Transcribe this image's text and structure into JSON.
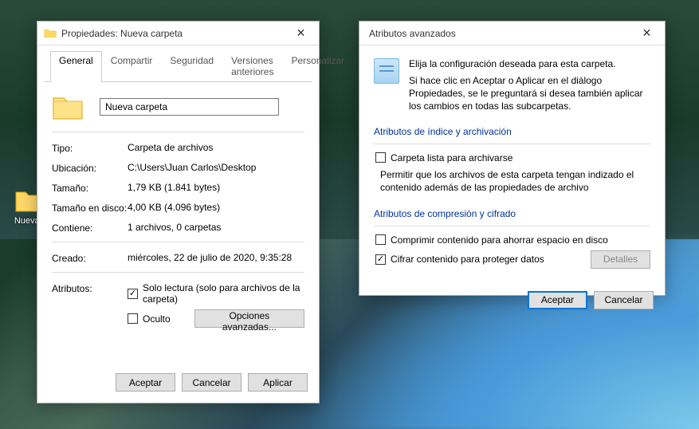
{
  "desktop": {
    "icon_label": "Nueva c"
  },
  "props": {
    "title": "Propiedades: Nueva carpeta",
    "tabs": {
      "general": "General",
      "compartir": "Compartir",
      "seguridad": "Seguridad",
      "versiones": "Versiones anteriores",
      "personalizar": "Personalizar"
    },
    "name_value": "Nueva carpeta",
    "tipo_label": "Tipo:",
    "tipo_value": "Carpeta de archivos",
    "ubicacion_label": "Ubicación:",
    "ubicacion_value": "C:\\Users\\Juan Carlos\\Desktop",
    "tamano_label": "Tamaño:",
    "tamano_value": "1,79 KB (1.841 bytes)",
    "tamano_disco_label": "Tamaño en disco:",
    "tamano_disco_value": "4,00 KB (4.096 bytes)",
    "contiene_label": "Contiene:",
    "contiene_value": "1 archivos, 0 carpetas",
    "creado_label": "Creado:",
    "creado_value": "miércoles, 22 de julio de 2020, 9:35:28",
    "atributos_label": "Atributos:",
    "solo_lectura_label": "Solo lectura (solo para archivos de la carpeta)",
    "oculto_label": "Oculto",
    "opciones_avanzadas_btn": "Opciones avanzadas...",
    "aceptar_btn": "Aceptar",
    "cancelar_btn": "Cancelar",
    "aplicar_btn": "Aplicar"
  },
  "adv": {
    "title": "Atributos avanzados",
    "intro_line1": "Elija la configuración deseada para esta carpeta.",
    "intro_line2": "Si hace clic en Aceptar o Aplicar en el diálogo Propiedades, se le preguntará si desea también aplicar los cambios en todas las subcarpetas.",
    "group1_label": "Atributos de índice y archivación",
    "check_archivar": "Carpeta lista para archivarse",
    "check_indizar": "Permitir que los archivos de esta carpeta tengan indizado el contenido además de las propiedades de archivo",
    "group2_label": "Atributos de compresión y cifrado",
    "check_comprimir": "Comprimir contenido para ahorrar espacio en disco",
    "check_cifrar": "Cifrar contenido para proteger datos",
    "detalles_btn": "Detalles",
    "aceptar_btn": "Aceptar",
    "cancelar_btn": "Cancelar"
  }
}
